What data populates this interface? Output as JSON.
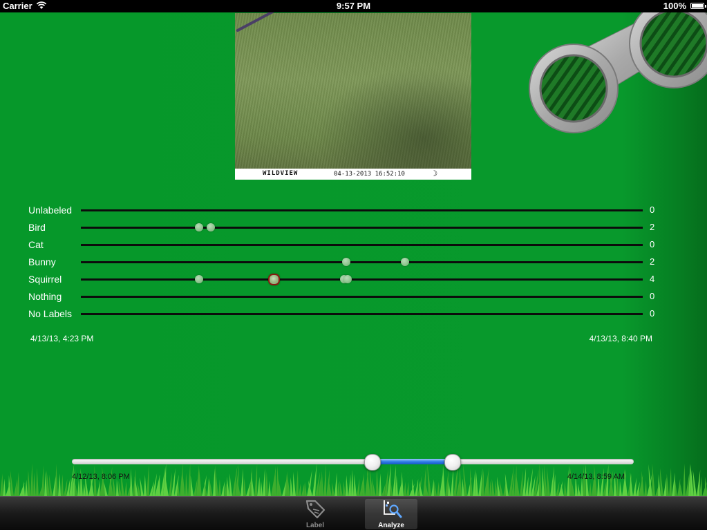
{
  "status_bar": {
    "carrier": "Carrier",
    "time": "9:57 PM",
    "battery": "100%"
  },
  "photo": {
    "brand": "WILDVIEW",
    "timestamp": "04-13-2013 16:52:10",
    "moon_icon": "crescent-moon"
  },
  "chart_data": {
    "type": "scatter",
    "x_start_label": "4/13/13, 4:23 PM",
    "x_end_label": "4/13/13, 8:40 PM",
    "categories": [
      "Unlabeled",
      "Bird",
      "Cat",
      "Bunny",
      "Squirrel",
      "Nothing",
      "No Labels"
    ],
    "counts": [
      "0",
      "2",
      "0",
      "2",
      "4",
      "0",
      "0"
    ],
    "points": [
      {
        "category": "Bird",
        "t": 0.21
      },
      {
        "category": "Bird",
        "t": 0.231
      },
      {
        "category": "Bunny",
        "t": 0.472
      },
      {
        "category": "Bunny",
        "t": 0.577
      },
      {
        "category": "Squirrel",
        "t": 0.21
      },
      {
        "category": "Squirrel",
        "t": 0.344,
        "selected": true
      },
      {
        "category": "Squirrel",
        "t": 0.469
      },
      {
        "category": "Squirrel",
        "t": 0.475
      }
    ],
    "dot_color": "#8fc58f",
    "selected_border_color": "#8a1a12"
  },
  "range_slider": {
    "min_label": "4/12/13, 8:06 PM",
    "max_label": "4/14/13, 8:59 AM",
    "low": 0.534,
    "high": 0.676,
    "fill_color": "#2f7fe8"
  },
  "tab_bar": {
    "tabs": [
      {
        "label": "Label",
        "icon": "tag-icon",
        "active": false
      },
      {
        "label": "Analyze",
        "icon": "analyze-magnifier-icon",
        "active": true
      }
    ]
  },
  "colors": {
    "background": "#08992c",
    "line": "#0c0c0c"
  }
}
